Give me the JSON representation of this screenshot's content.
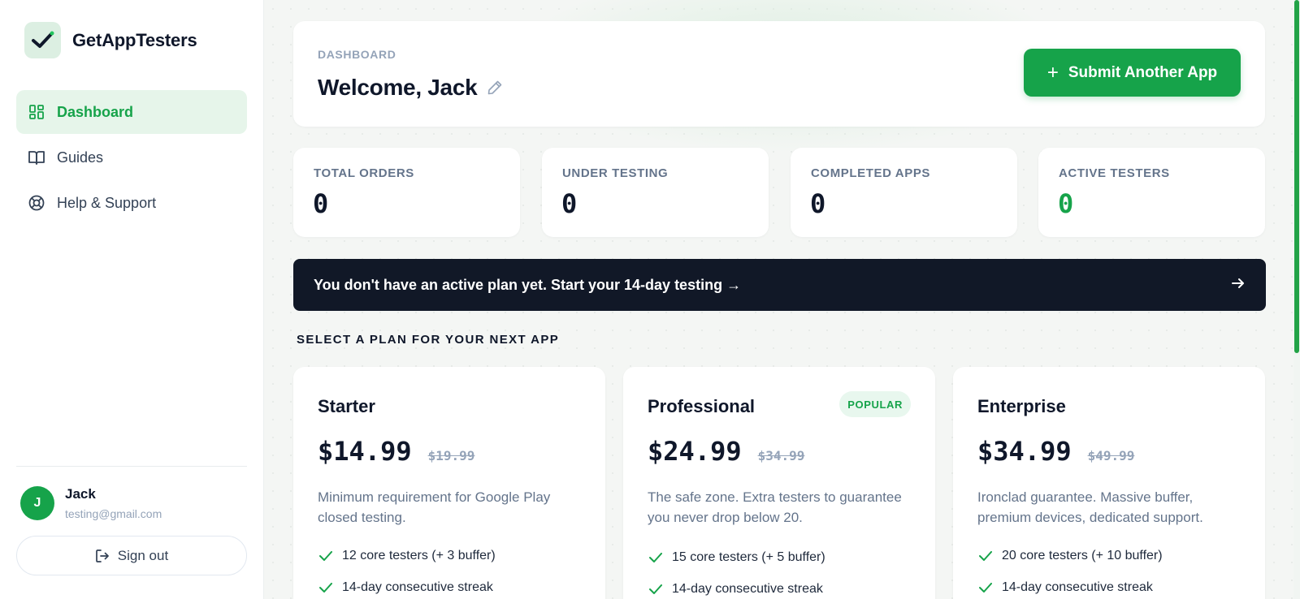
{
  "brand": {
    "name": "GetAppTesters",
    "logo_icon": "check-logo-icon"
  },
  "sidebar": {
    "items": [
      {
        "label": "Dashboard",
        "icon": "dashboard-grid-icon",
        "active": true
      },
      {
        "label": "Guides",
        "icon": "book-icon",
        "active": false
      },
      {
        "label": "Help & Support",
        "icon": "lifebuoy-icon",
        "active": false
      }
    ]
  },
  "user": {
    "initial": "J",
    "name": "Jack",
    "email": "testing@gmail.com"
  },
  "signout_label": "Sign out",
  "header": {
    "eyebrow": "DASHBOARD",
    "welcome": "Welcome, Jack",
    "submit_label": "Submit Another App"
  },
  "stats": [
    {
      "label": "TOTAL ORDERS",
      "value": "0"
    },
    {
      "label": "UNDER TESTING",
      "value": "0"
    },
    {
      "label": "COMPLETED APPS",
      "value": "0"
    },
    {
      "label": "ACTIVE TESTERS",
      "value": "0"
    }
  ],
  "banner": {
    "text": "You don't have an active plan yet. Start your 14-day testing →"
  },
  "plans_title": "SELECT A PLAN FOR YOUR NEXT APP",
  "plans": [
    {
      "name": "Starter",
      "price": "$14.99",
      "old_price": "$19.99",
      "badge": "",
      "description": "Minimum requirement for Google Play closed testing.",
      "features": [
        "12 core testers (+ 3 buffer)",
        "14-day consecutive streak"
      ]
    },
    {
      "name": "Professional",
      "price": "$24.99",
      "old_price": "$34.99",
      "badge": "POPULAR",
      "description": "The safe zone. Extra testers to guarantee you never drop below 20.",
      "features": [
        "15 core testers (+ 5 buffer)",
        "14-day consecutive streak"
      ]
    },
    {
      "name": "Enterprise",
      "price": "$34.99",
      "old_price": "$49.99",
      "badge": "",
      "description": "Ironclad guarantee. Massive buffer, premium devices, dedicated support.",
      "features": [
        "20 core testers (+ 10 buffer)",
        "14-day consecutive streak"
      ]
    }
  ],
  "colors": {
    "accent": "#16a34a",
    "banner_bg": "#111827",
    "active_bg": "#e6f5ea"
  }
}
